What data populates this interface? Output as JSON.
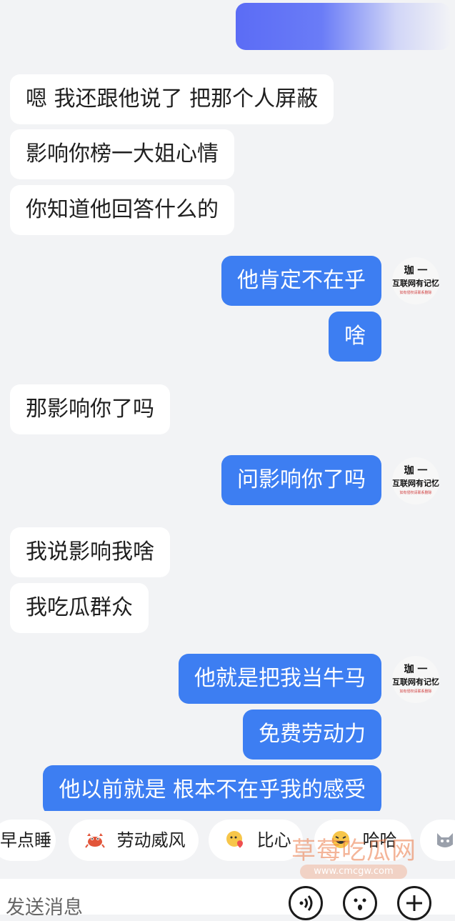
{
  "messages": {
    "m1": "嗯 我还跟他说了 把那个人屏蔽",
    "m2": "影响你榜一大姐心情",
    "m3": "你知道他回答什么的",
    "m4": "他肯定不在乎",
    "m5": "啥",
    "m6": "那影响你了吗",
    "m7": "问影响你了吗",
    "m8": "我说影响我啥",
    "m9": "我吃瓜群众",
    "m10": "他就是把我当牛马",
    "m11": "免费劳动力",
    "m12": "他以前就是 根本不在乎我的感受"
  },
  "avatar": {
    "name": "珈 一",
    "subtitle": "互联网有记忆",
    "tiny": "如有侵权请联系删除"
  },
  "quick_replies": {
    "r1": "早点睡",
    "r2": "劳动威风",
    "r3": "比心",
    "r4": "哈哈"
  },
  "watermark": {
    "text": "草莓吃瓜网",
    "url": "www.cmcgw.com"
  },
  "input": {
    "placeholder": "发送消息"
  },
  "colors": {
    "outgoing_bubble": "#3d7ef2",
    "incoming_bubble": "#ffffff",
    "background": "#f2f3f5"
  }
}
